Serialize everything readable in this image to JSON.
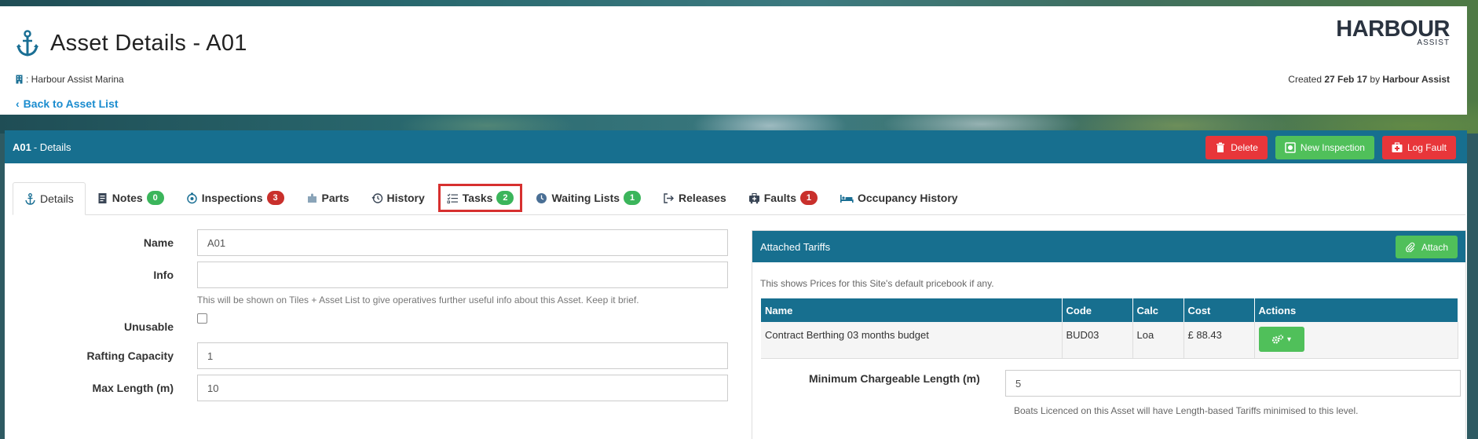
{
  "header": {
    "title": "Asset Details - A01",
    "site": ": Harbour Assist Marina",
    "back_link": "Back to Asset List",
    "logo_main": "HARBOUR",
    "logo_sub": "ASSIST",
    "created_prefix": "Created",
    "created_date": "27 Feb 17",
    "created_by_prefix": "by",
    "created_by": "Harbour Assist"
  },
  "panel": {
    "asset_code": "A01",
    "heading_suffix": "- Details",
    "buttons": {
      "delete": "Delete",
      "new_inspection": "New Inspection",
      "log_fault": "Log Fault"
    }
  },
  "tabs": [
    {
      "label": "Details"
    },
    {
      "label": "Notes",
      "badge": "0"
    },
    {
      "label": "Inspections",
      "badge": "3"
    },
    {
      "label": "Parts"
    },
    {
      "label": "History"
    },
    {
      "label": "Tasks",
      "badge": "2"
    },
    {
      "label": "Waiting Lists",
      "badge": "1"
    },
    {
      "label": "Releases"
    },
    {
      "label": "Faults",
      "badge": "1"
    },
    {
      "label": "Occupancy History"
    }
  ],
  "form": {
    "name_label": "Name",
    "name_value": "A01",
    "info_label": "Info",
    "info_value": "",
    "info_help": "This will be shown on Tiles + Asset List to give operatives further useful info about this Asset. Keep it brief.",
    "unusable_label": "Unusable",
    "rafting_label": "Rafting Capacity",
    "rafting_value": "1",
    "maxlen_label": "Max Length (m)",
    "maxlen_value": "10"
  },
  "tariffs": {
    "title": "Attached Tariffs",
    "attach": "Attach",
    "note": "This shows Prices for this Site's default pricebook if any.",
    "columns": [
      "Name",
      "Code",
      "Calc",
      "Cost",
      "Actions"
    ],
    "rows": [
      {
        "name": "Contract Berthing 03 months budget",
        "code": "BUD03",
        "calc": "Loa",
        "cost": "£ 88.43"
      }
    ],
    "min_label": "Minimum Chargeable Length (m)",
    "min_value": "5",
    "min_help": "Boats Licenced on this Asset will have Length-based Tariffs minimised to this level."
  },
  "colors": {
    "brand": "#176f8f",
    "danger": "#e8363a",
    "success": "#50c05a",
    "link": "#1a8ccf",
    "highlight": "#d7302f"
  }
}
